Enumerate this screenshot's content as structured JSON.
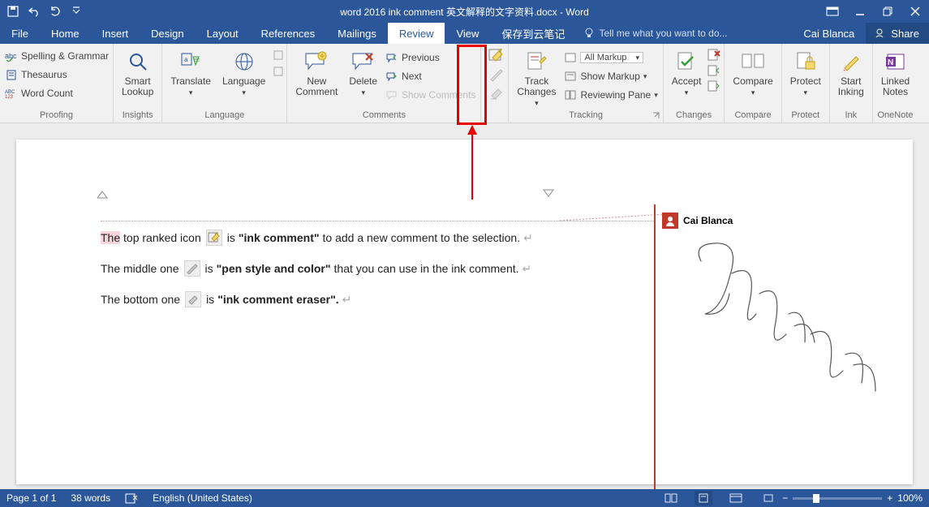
{
  "title": "word 2016 ink comment 英文解释的文字资料.docx - Word",
  "tabs": {
    "file": "File",
    "home": "Home",
    "insert": "Insert",
    "design": "Design",
    "layout": "Layout",
    "references": "References",
    "mailings": "Mailings",
    "review": "Review",
    "view": "View",
    "cloud": "保存到云笔记"
  },
  "tellme": "Tell me what you want to do...",
  "user": "Cai Blanca",
  "share": "Share",
  "ribbon": {
    "proofing": {
      "label": "Proofing",
      "spell": "Spelling & Grammar",
      "thes": "Thesaurus",
      "wc": "Word Count"
    },
    "insights": {
      "label": "Insights",
      "smart": "Smart\nLookup"
    },
    "language": {
      "label": "Language",
      "translate": "Translate",
      "lang": "Language"
    },
    "comments": {
      "label": "Comments",
      "new": "New\nComment",
      "delete": "Delete",
      "prev": "Previous",
      "next": "Next",
      "show": "Show Comments"
    },
    "ink": {
      "label": "Ink"
    },
    "tracking": {
      "label": "Tracking",
      "track": "Track\nChanges",
      "all": "All Markup",
      "showm": "Show Markup",
      "rp": "Reviewing Pane"
    },
    "changes": {
      "label": "Changes",
      "accept": "Accept"
    },
    "compare": {
      "label": "Compare",
      "compare": "Compare"
    },
    "protect": {
      "label": "Protect",
      "protect": "Protect"
    },
    "inking": {
      "label": "Ink",
      "start": "Start\nInking"
    },
    "onenote": {
      "label": "OneNote",
      "ln": "Linked\nNotes"
    }
  },
  "doc": {
    "l1a": "The top ranked icon",
    "l1b": "is",
    "l1c": "\"ink comment\"",
    "l1d": "to add a new comment to the selection.",
    "l2a": "The middle one",
    "l2b": "is",
    "l2c": "\"pen style and color\"",
    "l2d": "that you can use in the ink comment.",
    "l3a": "The bottom one",
    "l3b": "is",
    "l3c": "\"ink comment eraser\"."
  },
  "comment": {
    "author": "Cai Blanca"
  },
  "status": {
    "page": "Page 1 of 1",
    "words": "38 words",
    "lang": "English (United States)",
    "zoom_plus": "+",
    "zoom_minus": "−",
    "zoom": "100%"
  }
}
